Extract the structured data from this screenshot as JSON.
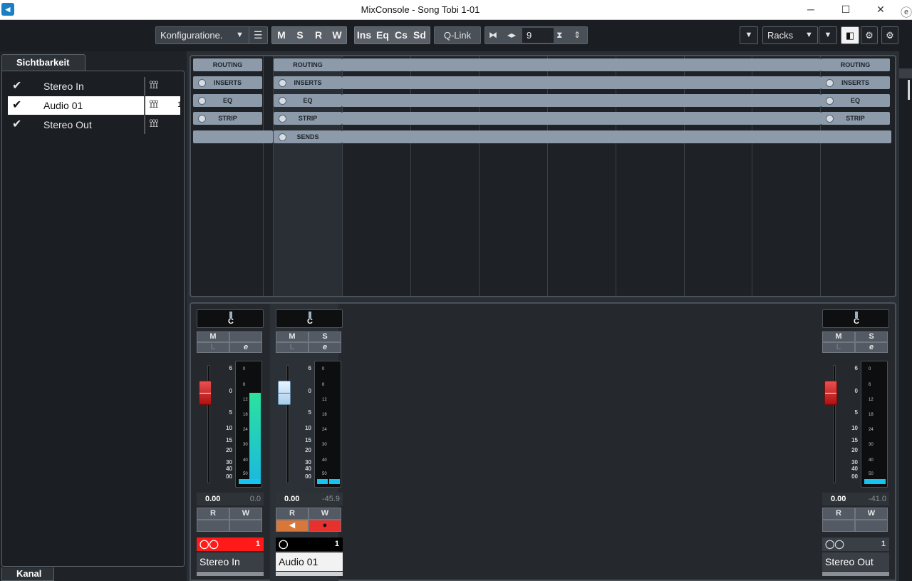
{
  "window": {
    "title": "MixConsole - Song Tobi 1-01",
    "minimize": "─",
    "maximize": "☐",
    "close": "✕"
  },
  "toolbar": {
    "config": "Konfiguratione.",
    "m": "M",
    "s": "S",
    "r": "R",
    "w": "W",
    "ins": "Ins",
    "eq": "Eq",
    "cs": "Cs",
    "sd": "Sd",
    "qlink": "Q-Link",
    "channels_value": "9",
    "racks": "Racks"
  },
  "left_panel": {
    "tab_label": "Sichtbarkeit",
    "footer_tab": "Kanal",
    "items": [
      {
        "label": "Stereo In",
        "checked": "✔"
      },
      {
        "label": "Audio 01",
        "checked": "✔",
        "num": "1"
      },
      {
        "label": "Stereo Out",
        "checked": "✔"
      }
    ]
  },
  "rack": {
    "ch1": {
      "routing": "ROUTING",
      "inserts": "INSERTS",
      "eq": "EQ",
      "strip": "STRIP"
    },
    "ch2": {
      "routing": "ROUTING",
      "inserts": "INSERTS",
      "eq": "EQ",
      "strip": "STRIP",
      "sends": "SENDS"
    },
    "ch3": {
      "routing": "ROUTING",
      "inserts": "INSERTS",
      "eq": "EQ",
      "strip": "STRIP"
    }
  },
  "channels": [
    {
      "name": "Stereo In",
      "pan": "C",
      "mute": "M",
      "solo": "",
      "listen": "L",
      "edit": "e",
      "volume": "0.00",
      "peak": "0.0",
      "read": "R",
      "write": "W",
      "number": "1",
      "fader_color": "red",
      "meter_level": 0.85
    },
    {
      "name": "Audio 01",
      "pan": "C",
      "mute": "M",
      "solo": "S",
      "listen": "L",
      "edit": "e",
      "volume": "0.00",
      "peak": "-45.9",
      "read": "R",
      "write": "W",
      "number": "1",
      "fader_color": "blue",
      "meter_level": 0.04
    },
    {
      "name": "Stereo Out",
      "pan": "C",
      "mute": "M",
      "solo": "S",
      "listen": "L",
      "edit": "e",
      "volume": "0.00",
      "peak": "-41.0",
      "read": "R",
      "write": "W",
      "number": "1",
      "fader_color": "red",
      "meter_level": 0.04
    }
  ],
  "fader_scale": [
    "6",
    "0",
    "5",
    "10",
    "15",
    "20",
    "30",
    "40",
    "00"
  ],
  "meter_scale": [
    "0",
    "6",
    "12",
    "18",
    "24",
    "30",
    "40",
    "50"
  ],
  "colors": {
    "stereo_in_bar": "#ff1a1a",
    "audio_bar": "#000000",
    "stereo_out_bar": "#3a3f45"
  }
}
